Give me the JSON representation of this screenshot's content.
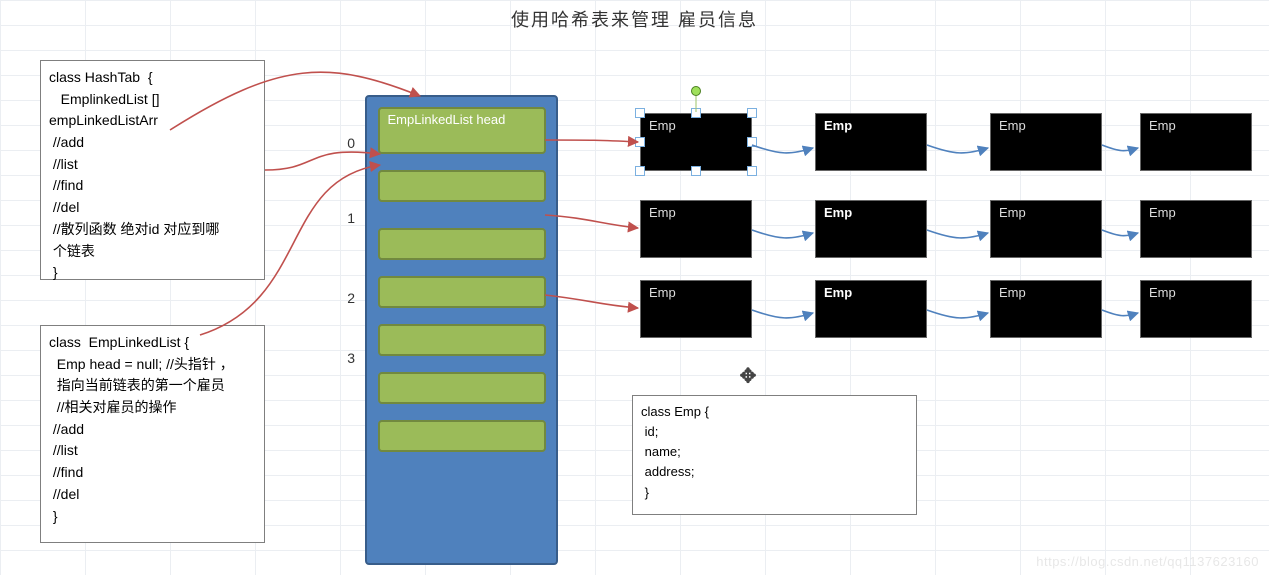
{
  "title": "使用哈希表来管理 雇员信息",
  "hashTabBox": "class HashTab  {\n   EmplinkedList []\nempLinkedListArr\n //add\n //list\n //find\n //del\n //散列函数 绝对id 对应到哪\n 个链表\n }",
  "empLinkedListBox": "class  EmpLinkedList {\n  Emp head = null; //头指针 ，\n  指向当前链表的第一个雇员\n  //相关对雇员的操作\n //add\n //list\n //find\n //del\n }",
  "empBox": "class Emp {\n id;\n name;\n address;\n }",
  "bucketLabel": "EmpLinkedList\nhead",
  "indices": [
    "0",
    "1",
    "2",
    "3"
  ],
  "empRows": [
    [
      {
        "label": "Emp",
        "bold": false,
        "selected": true
      },
      {
        "label": "Emp",
        "bold": true
      },
      {
        "label": "Emp",
        "bold": false
      },
      {
        "label": "Emp",
        "bold": false
      }
    ],
    [
      {
        "label": "Emp",
        "bold": false
      },
      {
        "label": "Emp",
        "bold": true
      },
      {
        "label": "Emp",
        "bold": false
      },
      {
        "label": "Emp",
        "bold": false
      }
    ],
    [
      {
        "label": "Emp",
        "bold": false
      },
      {
        "label": "Emp",
        "bold": true
      },
      {
        "label": "Emp",
        "bold": false
      },
      {
        "label": "Emp",
        "bold": false
      }
    ]
  ],
  "watermark": "https://blog.csdn.net/qq1137623160"
}
